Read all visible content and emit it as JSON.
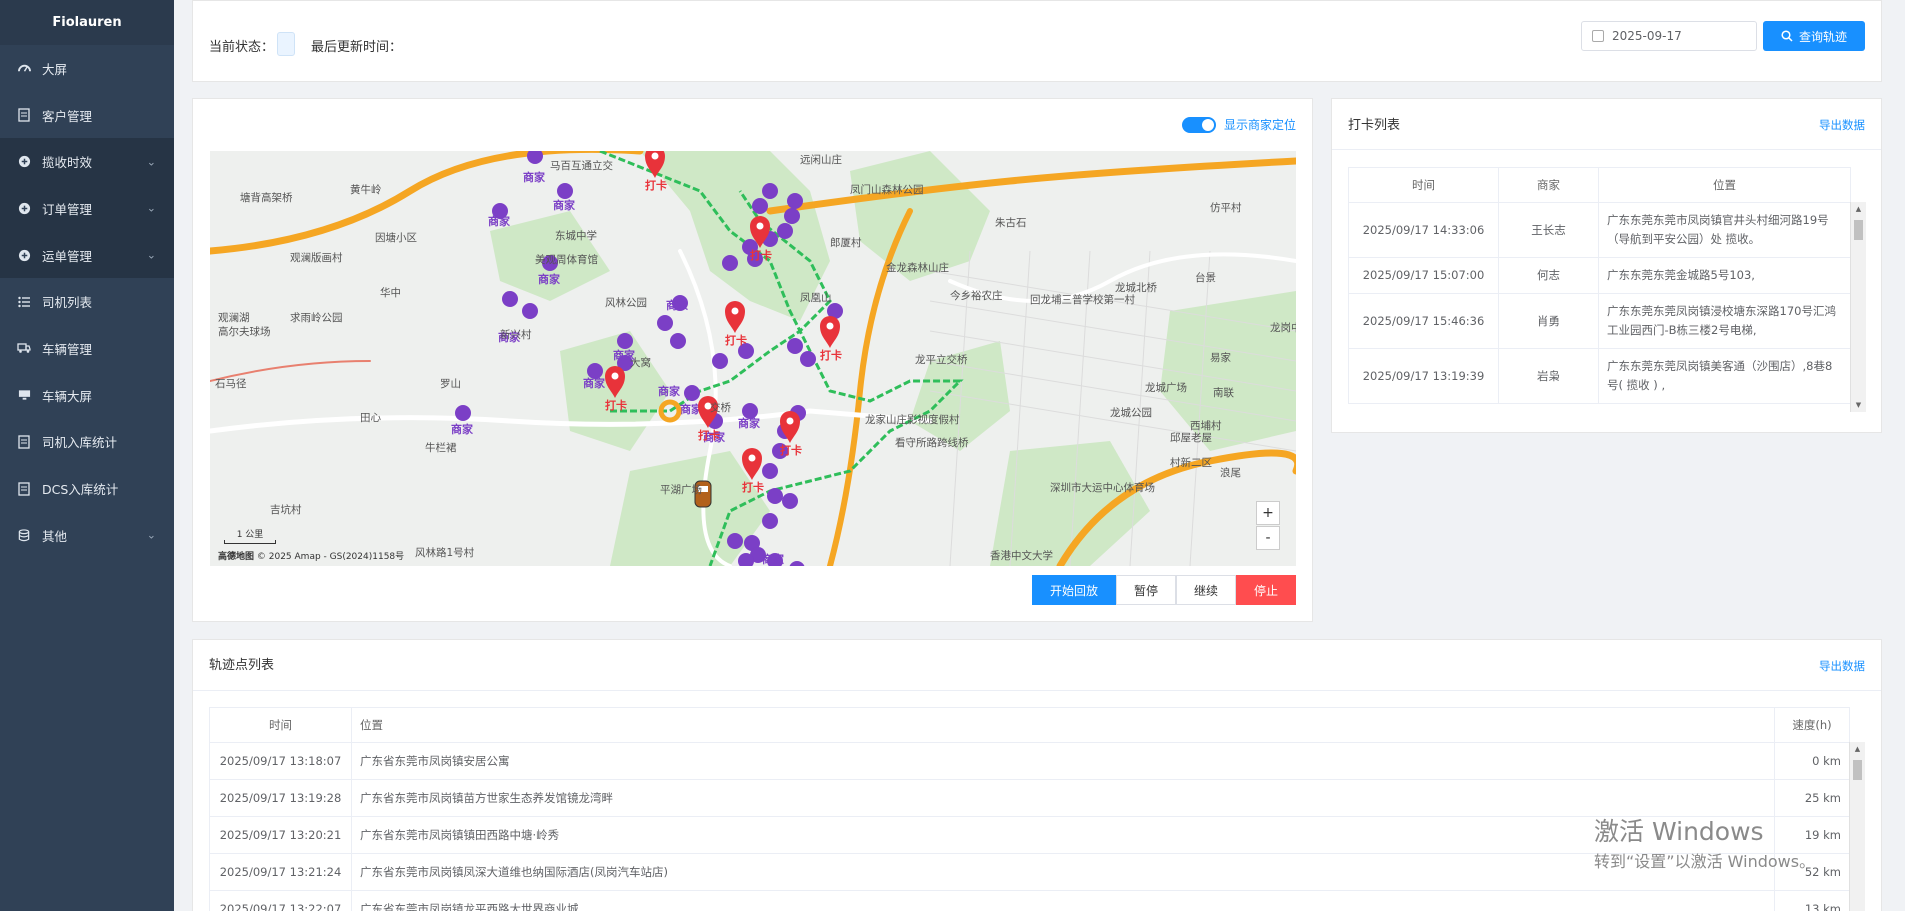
{
  "brand": "Fiolauren",
  "menu": [
    {
      "label": "大屏",
      "icon": "dashboard-icon",
      "expandable": false,
      "group": false
    },
    {
      "label": "客户管理",
      "icon": "document-icon",
      "expandable": false,
      "group": false
    },
    {
      "label": "揽收时效",
      "icon": "plus-circle-icon",
      "expandable": true,
      "group": true
    },
    {
      "label": "订单管理",
      "icon": "plus-circle-icon",
      "expandable": true,
      "group": true
    },
    {
      "label": "运单管理",
      "icon": "plus-circle-icon",
      "expandable": true,
      "group": true
    },
    {
      "label": "司机列表",
      "icon": "list-icon",
      "expandable": false,
      "group": false
    },
    {
      "label": "车辆管理",
      "icon": "truck-icon",
      "expandable": false,
      "group": false
    },
    {
      "label": "车辆大屏",
      "icon": "monitor-icon",
      "expandable": false,
      "group": false
    },
    {
      "label": "司机入库统计",
      "icon": "document-icon",
      "expandable": false,
      "group": false
    },
    {
      "label": "DCS入库统计",
      "icon": "document-icon",
      "expandable": false,
      "group": false
    },
    {
      "label": "其他",
      "icon": "database-icon",
      "expandable": true,
      "group": false
    }
  ],
  "topbar": {
    "status_label": "当前状态：",
    "updated_label": "最后更新时间：",
    "date_value": "2025-09-17",
    "query_button": "查询轨迹"
  },
  "map": {
    "toggle_label": "显示商家定位",
    "toggle_on": true,
    "zoom_in": "+",
    "zoom_out": "-",
    "scale_label": "1 公里",
    "attribution_brand": "高德地图",
    "attribution": "© 2025 Amap - GS(2024)1158号",
    "merchant_label": "商家",
    "checkin_label": "打卡",
    "place_labels": [
      "马百互通立交",
      "黄牛岭",
      "塘背高架桥",
      "因塘小区",
      "东城中学",
      "华中",
      "求雨岭公园",
      "观澜湖",
      "高尔夫球场",
      "石马径",
      "罗山",
      "田心",
      "牛栏裙",
      "吉坑村",
      "风林路1号村",
      "观澜版画村",
      "美观周体育馆",
      "风林公园",
      "新兴村",
      "大窝",
      "凤凰山",
      "远闲山庄",
      "凤门山森林公园",
      "郎厦村",
      "金龙森林山庄",
      "朱古石",
      "今乡裕农庄",
      "回龙埔三普学校第一村",
      "龙城北桥",
      "台景",
      "仿平村",
      "龙平立交桥",
      "龙城广场",
      "龙城公园",
      "南联",
      "龙岗中心",
      "西埔村",
      "邱屋老屋",
      "看守所路跨线桥",
      "深圳市大运中心体育场",
      "香港中文大学",
      "村新二区",
      "平湖广场",
      "龙家山庄影视度假村",
      "交桥",
      "浪尾",
      "易家"
    ],
    "colors": {
      "route": "#2fbe5a",
      "merchant": "#7b3fc6",
      "checkin": "#e8333a",
      "highway": "#f5a623",
      "park": "#cde8c3"
    }
  },
  "playback": {
    "start": "开始回放",
    "pause": "暂停",
    "resume": "继续",
    "stop": "停止"
  },
  "checkin": {
    "title": "打卡列表",
    "export": "导出数据",
    "columns": [
      "时间",
      "商家",
      "位置"
    ],
    "rows": [
      {
        "time": "2025/09/17 14:33:06",
        "merchant": "王长志",
        "location": "广东东莞东莞市凤岗镇官井头村细河路19号（导航到平安公园）处 揽收。"
      },
      {
        "time": "2025/09/17 15:07:00",
        "merchant": "何志",
        "location": "广东东莞东莞金城路5号103,"
      },
      {
        "time": "2025/09/17 15:46:36",
        "merchant": "肖勇",
        "location": "广东东莞东莞凤岗镇浸校塘东深路170号汇鸿工业园西门-B栋三楼2号电梯,"
      },
      {
        "time": "2025/09/17 13:19:39",
        "merchant": "岩枭",
        "location": "广东东莞东莞凤岗镇美客通（沙围店）,8巷8号( 揽收 ) ,"
      }
    ]
  },
  "track": {
    "title": "轨迹点列表",
    "export": "导出数据",
    "columns": [
      "时间",
      "位置",
      "速度(h)"
    ],
    "rows": [
      {
        "time": "2025/09/17 13:18:07",
        "location": "广东省东莞市凤岗镇安居公寓",
        "speed": "0 km"
      },
      {
        "time": "2025/09/17 13:19:28",
        "location": "广东省东莞市凤岗镇苗方世家生态养发馆镜龙湾畔",
        "speed": "25 km"
      },
      {
        "time": "2025/09/17 13:20:21",
        "location": "广东省东莞市凤岗镇镇田西路中塘·岭秀",
        "speed": "19 km"
      },
      {
        "time": "2025/09/17 13:21:24",
        "location": "广东省东莞市凤岗镇凤深大道维也纳国际酒店(凤岗汽车站店)",
        "speed": "52 km"
      },
      {
        "time": "2025/09/17 13:22:07",
        "location": "广东省东莞市凤岗镇龙平西路大世界商业城",
        "speed": "13 km"
      }
    ]
  },
  "watermark": {
    "line1": "激活 Windows",
    "line2": "转到“设置”以激活 Windows。"
  }
}
